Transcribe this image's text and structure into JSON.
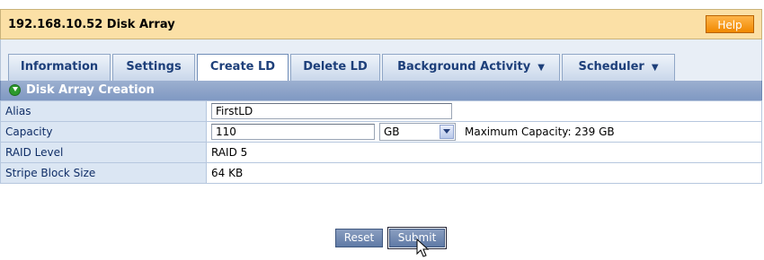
{
  "header": {
    "title": "192.168.10.52 Disk Array",
    "help_label": "Help"
  },
  "tabs": [
    {
      "label": "Information",
      "active": false,
      "has_menu": false
    },
    {
      "label": "Settings",
      "active": false,
      "has_menu": false
    },
    {
      "label": "Create LD",
      "active": true,
      "has_menu": false
    },
    {
      "label": "Delete LD",
      "active": false,
      "has_menu": false
    },
    {
      "label": "Background Activity",
      "active": false,
      "has_menu": true
    },
    {
      "label": "Scheduler",
      "active": false,
      "has_menu": true
    }
  ],
  "section": {
    "title": "Disk Array Creation",
    "icon": "expand-arrow-icon"
  },
  "form": {
    "alias": {
      "label": "Alias",
      "value": "FirstLD"
    },
    "capacity": {
      "label": "Capacity",
      "value": "110",
      "unit": "GB",
      "max_text": "Maximum Capacity: 239 GB"
    },
    "raid_level": {
      "label": "RAID Level",
      "value": "RAID 5"
    },
    "stripe": {
      "label": "Stripe Block Size",
      "value": "64 KB"
    }
  },
  "buttons": {
    "reset": "Reset",
    "submit": "Submit"
  },
  "colors": {
    "header_bg": "#fbe0a6",
    "help_button": "#f08800",
    "section_bar": "#8ea4c9",
    "tab_text": "#1d3f7a"
  }
}
